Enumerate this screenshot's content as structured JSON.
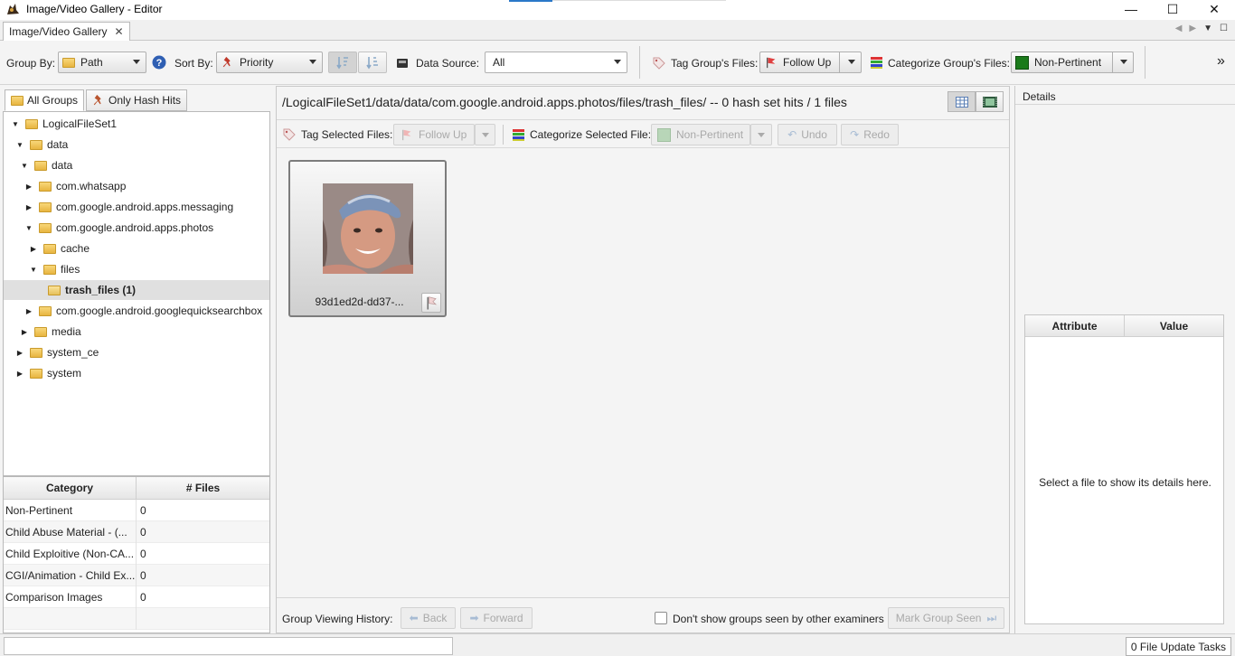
{
  "window": {
    "title": "Image/Video Gallery - Editor",
    "minimize_glyph": "—",
    "maximize_glyph": "☐",
    "close_glyph": "✕"
  },
  "tabs": [
    {
      "label": "Image/Video Gallery",
      "close_glyph": "✕"
    }
  ],
  "toolbar": {
    "group_by_label": "Group By:",
    "group_by_value": "Path",
    "sort_by_label": "Sort By:",
    "sort_by_value": "Priority",
    "data_source_label": "Data Source:",
    "data_source_value": "All",
    "tag_group_label": "Tag Group's Files:",
    "tag_group_value": "Follow Up",
    "categorize_group_label": "Categorize Group's Files:",
    "categorize_group_value": "Non-Pertinent",
    "overflow_glyph": "»"
  },
  "left": {
    "tabs": [
      "All Groups",
      "Only Hash Hits"
    ],
    "tree": [
      {
        "label": "LogicalFileSet1",
        "expanded": true
      },
      {
        "label": "data",
        "expanded": true
      },
      {
        "label": "data",
        "expanded": true
      },
      {
        "label": "com.whatsapp",
        "expanded": false
      },
      {
        "label": "com.google.android.apps.messaging",
        "expanded": false
      },
      {
        "label": "com.google.android.apps.photos",
        "expanded": true
      },
      {
        "label": "cache",
        "expanded": false
      },
      {
        "label": "files",
        "expanded": true
      },
      {
        "label": "trash_files (1)",
        "expanded": null,
        "selected": true
      },
      {
        "label": "com.google.android.googlequicksearchbox",
        "expanded": false
      },
      {
        "label": "media",
        "expanded": false
      },
      {
        "label": "system_ce",
        "expanded": false
      },
      {
        "label": "system",
        "expanded": false
      }
    ],
    "category_table": {
      "headers": [
        "Category",
        "# Files"
      ],
      "rows": [
        [
          "Non-Pertinent",
          "0"
        ],
        [
          "Child Abuse Material - (...",
          "0"
        ],
        [
          "Child Exploitive (Non-CA...",
          "0"
        ],
        [
          "CGI/Animation - Child Ex...",
          "0"
        ],
        [
          "Comparison Images",
          "0"
        ]
      ]
    }
  },
  "center": {
    "path": "/LogicalFileSet1/data/data/com.google.android.apps.photos/files/trash_files/ -- 0 hash set hits / 1 files",
    "tag_selected_label": "Tag Selected Files:",
    "tag_selected_value": "Follow Up",
    "categorize_selected_label": "Categorize Selected File:",
    "categorize_selected_value": "Non-Pertinent",
    "undo_label": "Undo",
    "redo_label": "Redo",
    "tile_filename": "93d1ed2d-dd37-...",
    "history_label": "Group Viewing History:",
    "back_label": "Back",
    "forward_label": "Forward",
    "dont_show_label": "Don't show groups seen by other examiners",
    "mark_seen_label": "Mark Group Seen"
  },
  "right": {
    "title": "Details",
    "table_headers": [
      "Attribute",
      "Value"
    ],
    "empty_message": "Select a file to show its details here."
  },
  "status": {
    "tasks": "0 File Update Tasks"
  },
  "colors": {
    "non_pertinent": "#1a7a1a",
    "selection": "#e0e0e0",
    "accent": "#2a78c8"
  }
}
